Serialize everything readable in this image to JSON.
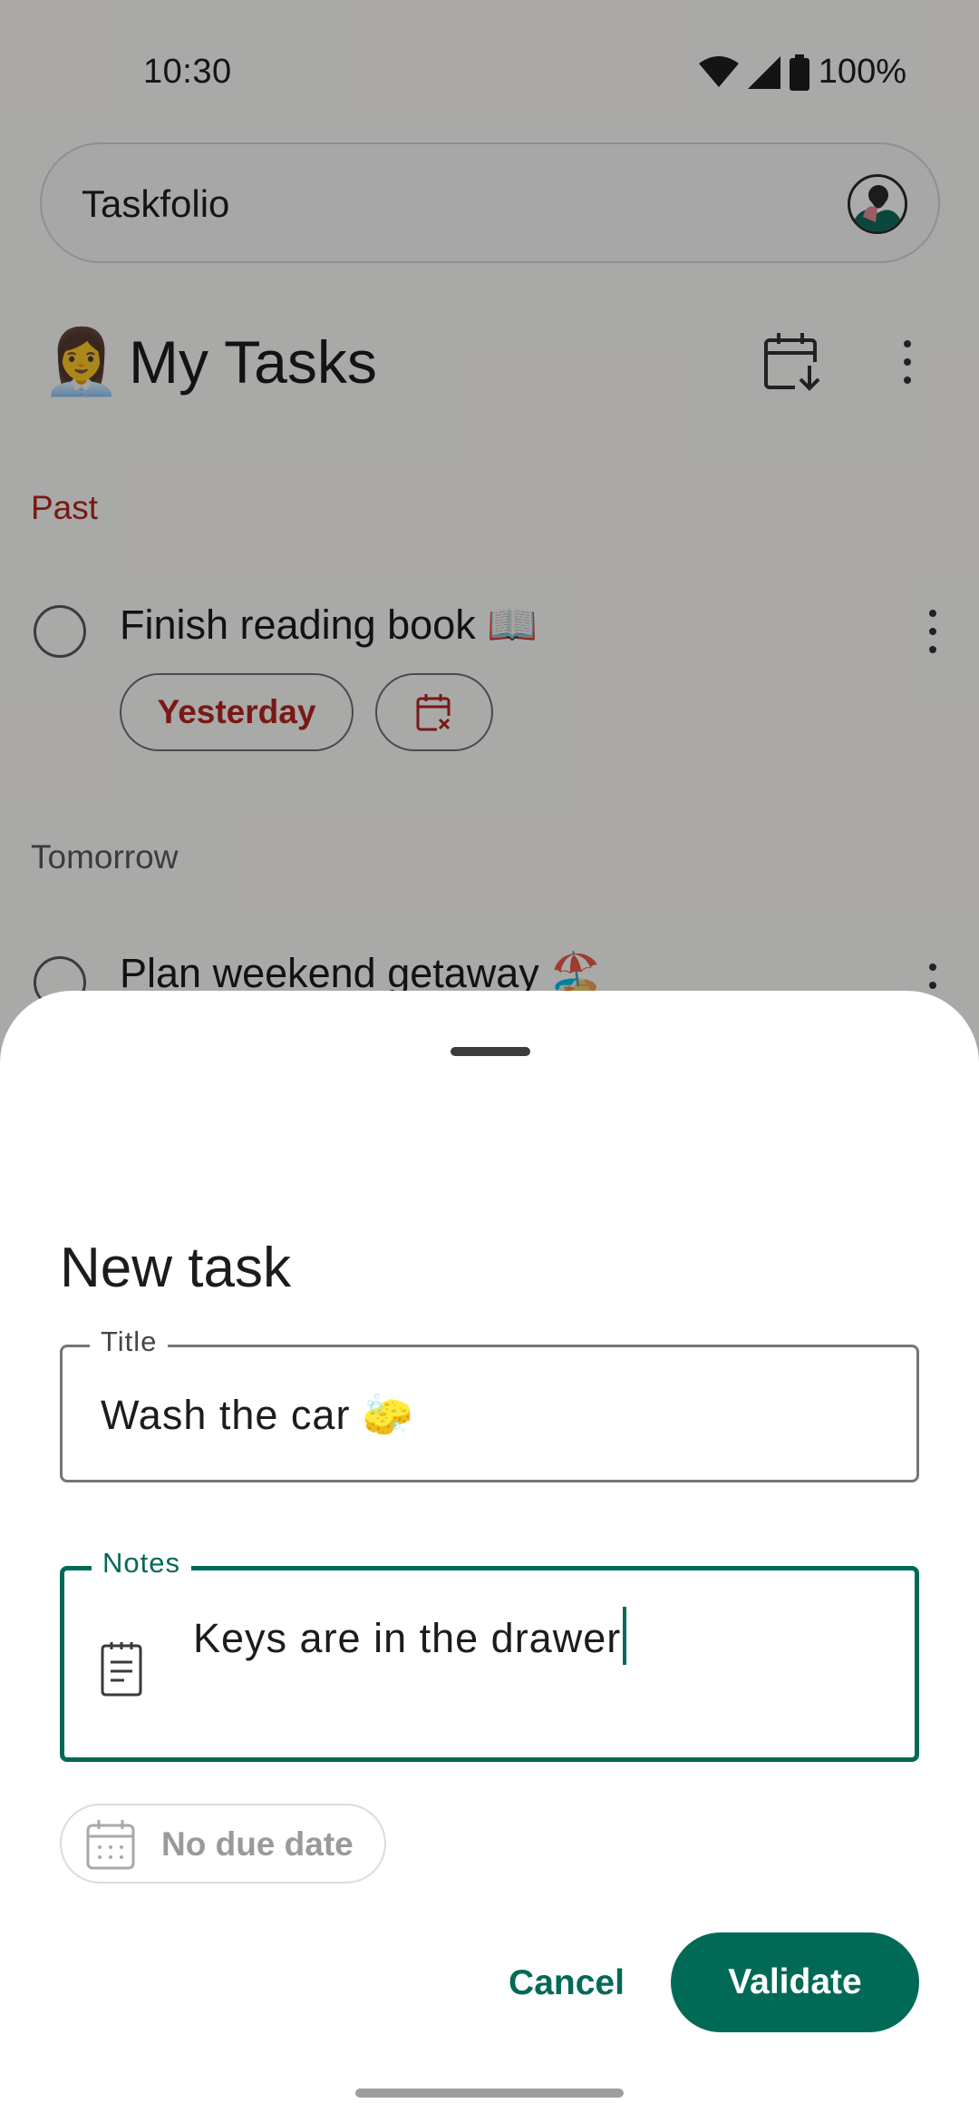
{
  "status_bar": {
    "time": "10:30",
    "battery": "100%"
  },
  "app": {
    "name": "Taskfolio"
  },
  "list": {
    "emoji": "👩‍💼",
    "title": "My Tasks"
  },
  "sections": {
    "past": {
      "label": "Past",
      "task": {
        "title": "Finish reading book 📖",
        "due_chip": "Yesterday"
      }
    },
    "tomorrow": {
      "label": "Tomorrow",
      "task": {
        "title": "Plan weekend getaway 🏖️"
      }
    }
  },
  "sheet": {
    "title": "New task",
    "title_field": {
      "label": "Title",
      "value": "Wash the car 🧽"
    },
    "notes_field": {
      "label": "Notes",
      "value": "Keys are in the drawer"
    },
    "due_date": "No due date",
    "cancel": "Cancel",
    "validate": "Validate"
  },
  "colors": {
    "accent": "#006a56",
    "overdue": "#b3261e"
  },
  "icons": [
    "wifi-icon",
    "signal-icon",
    "battery-icon",
    "calendar-download-icon",
    "more-vert-icon",
    "calendar-remove-icon",
    "notes-icon",
    "calendar-icon"
  ]
}
